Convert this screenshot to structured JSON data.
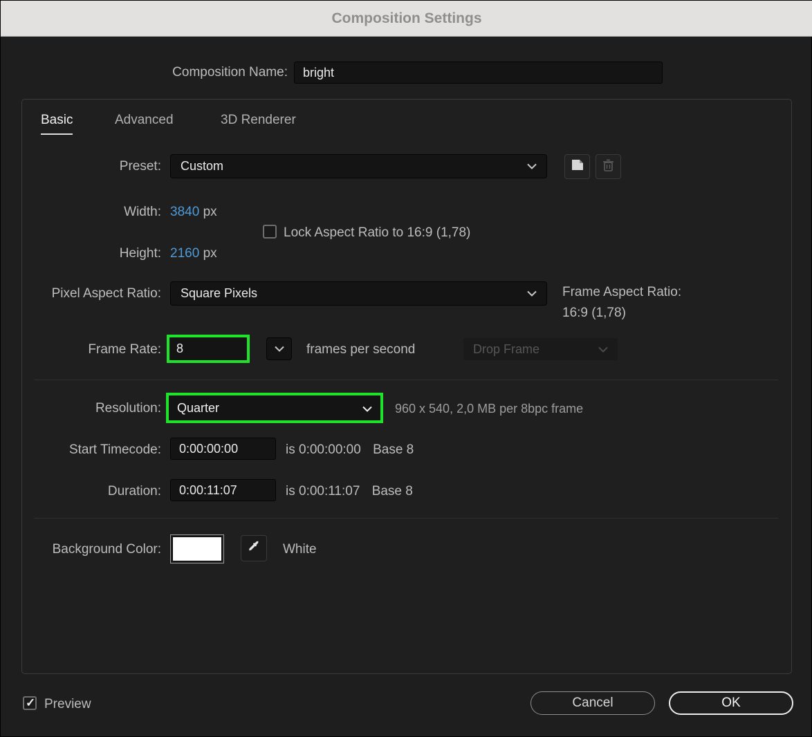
{
  "title_bar": {
    "title": "Composition Settings"
  },
  "composition_name": {
    "label": "Composition Name:",
    "value": "bright"
  },
  "tabs": {
    "basic": "Basic",
    "advanced": "Advanced",
    "renderer": "3D Renderer"
  },
  "preset": {
    "label": "Preset:",
    "value": "Custom"
  },
  "dimensions": {
    "width_label": "Width:",
    "width_value": "3840",
    "width_unit": "px",
    "height_label": "Height:",
    "height_value": "2160",
    "height_unit": "px",
    "lock_aspect_label": "Lock Aspect Ratio to 16:9 (1,78)",
    "lock_aspect_checked": false
  },
  "pixel_aspect_ratio": {
    "label": "Pixel Aspect Ratio:",
    "value": "Square Pixels"
  },
  "frame_aspect_ratio": {
    "label": "Frame Aspect Ratio:",
    "value": "16:9 (1,78)"
  },
  "frame_rate": {
    "label": "Frame Rate:",
    "value": "8",
    "suffix": "frames per second",
    "drop_frame_value": "Drop Frame"
  },
  "resolution": {
    "label": "Resolution:",
    "value": "Quarter",
    "info": "960 x 540, 2,0 MB per 8bpc frame"
  },
  "start_timecode": {
    "label": "Start Timecode:",
    "value": "0:00:00:00",
    "info": "is 0:00:00:00",
    "base": "Base 8"
  },
  "duration": {
    "label": "Duration:",
    "value": "0:00:11:07",
    "info": "is 0:00:11:07",
    "base": "Base 8"
  },
  "background_color": {
    "label": "Background Color:",
    "color_name": "White",
    "color_hex": "#ffffff"
  },
  "footer": {
    "preview_label": "Preview",
    "preview_checked": true,
    "cancel_label": "Cancel",
    "ok_label": "OK"
  },
  "colors": {
    "highlight_green": "#1fe32b",
    "value_blue": "#4e9bd8",
    "background": "#1e1e1e"
  }
}
